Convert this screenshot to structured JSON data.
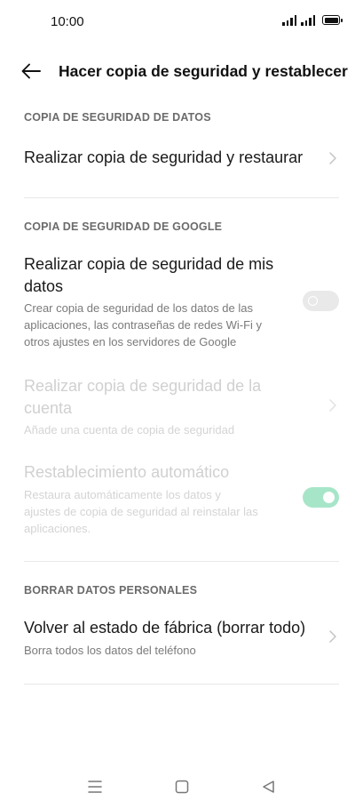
{
  "status_bar": {
    "time": "10:00"
  },
  "header": {
    "title": "Hacer copia de seguridad y restablecer"
  },
  "sections": [
    {
      "header": "COPIA DE SEGURIDAD DE DATOS",
      "items": [
        {
          "title": "Realizar copia de seguridad y restaurar"
        }
      ]
    },
    {
      "header": "COPIA DE SEGURIDAD DE GOOGLE",
      "items": [
        {
          "title_line1": "Realizar copia de seguridad de mis",
          "title_line2": "datos",
          "subtitle_line1": "Crear copia de seguridad de los datos de las",
          "subtitle_line2": "aplicaciones, las contraseñas de redes Wi-Fi y",
          "subtitle_line3": "otros ajustes en los servidores de Google",
          "toggle": "off"
        },
        {
          "title_line1": "Realizar copia de seguridad de la",
          "title_line2": "cuenta",
          "subtitle": "Añade una cuenta de copia de seguridad",
          "disabled": true
        },
        {
          "title": "Restablecimiento automático",
          "subtitle_line1": "Restaura automáticamente los datos y",
          "subtitle_line2": "ajustes de copia de seguridad al reinstalar las",
          "subtitle_line3": "aplicaciones.",
          "toggle": "on",
          "disabled": true
        }
      ]
    },
    {
      "header": "BORRAR DATOS PERSONALES",
      "items": [
        {
          "title": "Volver al estado de fábrica (borrar todo)",
          "subtitle": "Borra todos los datos del teléfono"
        }
      ]
    }
  ],
  "colors": {
    "toggle_on": "#a7e5c9",
    "toggle_off": "#e9e9e9",
    "section_header": "#6b6b6b",
    "disabled_text": "#d0d0d0"
  },
  "icons": {
    "back": "arrow-left-icon",
    "chevron": "chevron-right-icon",
    "nav_menu": "menu-icon",
    "nav_home": "square-home-icon",
    "nav_back": "triangle-back-icon"
  }
}
